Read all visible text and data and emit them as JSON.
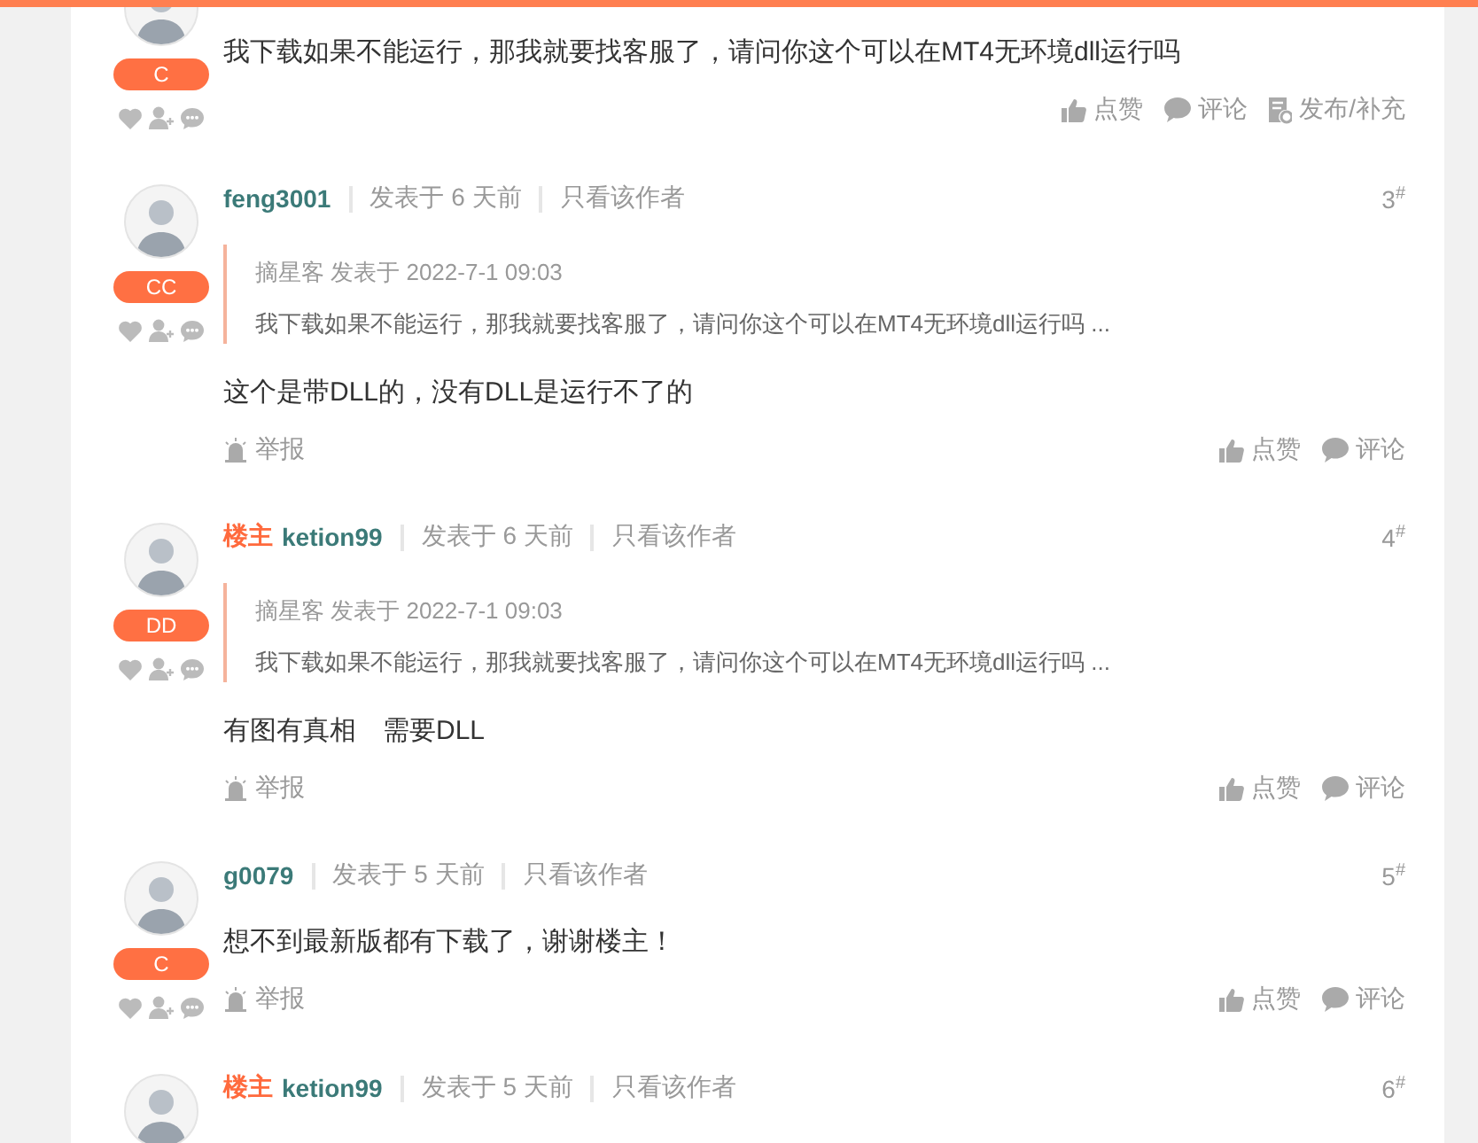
{
  "posts": [
    {
      "badge": "C",
      "body": "我下载如果不能运行，那我就要找客服了，请问你这个可以在MT4无环境dll运行吗",
      "actions": [
        {
          "kind": "like",
          "label": "点赞"
        },
        {
          "kind": "comment",
          "label": "评论"
        },
        {
          "kind": "publish",
          "label": "发布/补充"
        }
      ]
    },
    {
      "badge": "CC",
      "author": "feng3001",
      "posted": "发表于 6 天前",
      "filter_link": "只看该作者",
      "floor": "3$^{#}$",
      "quote": {
        "meta": "摘星客 发表于 2022-7-1 09:03",
        "text": "我下载如果不能运行，那我就要找客服了，请问你这个可以在MT4无环境dll运行吗 ..."
      },
      "body": "这个是带DLL的，没有DLL是运行不了的",
      "actions": [
        {
          "kind": "report",
          "label": "举报"
        },
        {
          "kind": "like",
          "label": "点赞"
        },
        {
          "kind": "comment",
          "label": "评论"
        }
      ]
    },
    {
      "badge": "DD",
      "op_label": "楼主",
      "author": "ketion99",
      "posted": "发表于 6 天前",
      "filter_link": "只看该作者",
      "floor": "4$^{#}$",
      "quote": {
        "meta": "摘星客 发表于 2022-7-1 09:03",
        "text": "我下载如果不能运行，那我就要找客服了，请问你这个可以在MT4无环境dll运行吗 ..."
      },
      "body": "有图有真相　需要DLL",
      "actions": [
        {
          "kind": "report",
          "label": "举报"
        },
        {
          "kind": "like",
          "label": "点赞"
        },
        {
          "kind": "comment",
          "label": "评论"
        }
      ]
    },
    {
      "badge": "C",
      "author": "g0079",
      "posted": "发表于 5 天前",
      "filter_link": "只看该作者",
      "floor": "5$^{#}$",
      "body": "想不到最新版都有下载了，谢谢楼主！",
      "actions": [
        {
          "kind": "report",
          "label": "举报"
        },
        {
          "kind": "like",
          "label": "点赞"
        },
        {
          "kind": "comment",
          "label": "评论"
        }
      ]
    },
    {
      "op_label": "楼主",
      "author": "ketion99",
      "posted": "发表于 5 天前",
      "filter_link": "只看该作者",
      "floor": "6$^{#}$"
    }
  ]
}
